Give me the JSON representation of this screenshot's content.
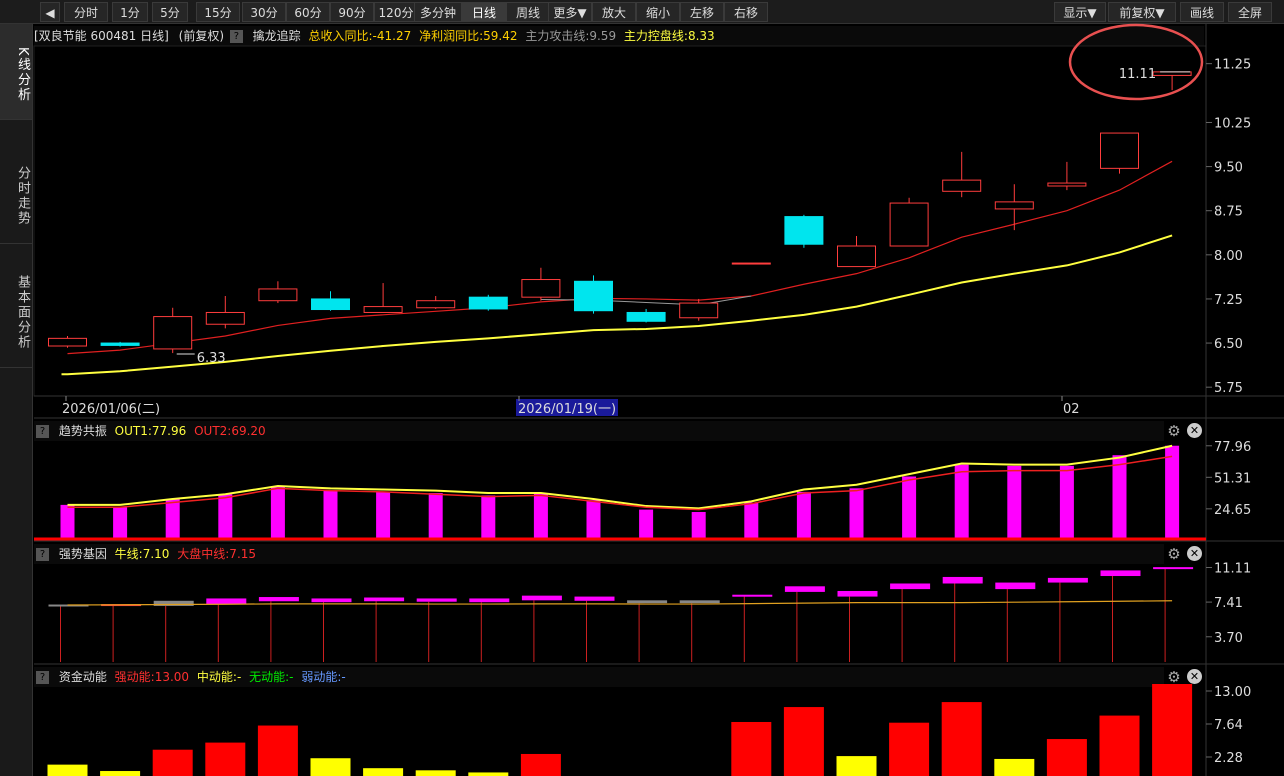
{
  "toolbar": {
    "buttons": [
      "分时",
      "1分",
      "5分",
      "15分",
      "30分",
      "60分",
      "90分",
      "120分",
      "多分钟",
      "日线",
      "周线",
      "更多▼",
      "放大",
      "缩小",
      "左移",
      "右移"
    ],
    "active": "日线",
    "right_buttons": [
      "显示▼",
      "前复权▼",
      "画线",
      "全屏"
    ]
  },
  "sidenav": {
    "items": [
      "K线分析",
      "分时走势",
      "基本面分析"
    ]
  },
  "main_panel": {
    "title": "[双良节能 600481 日线]",
    "adjust": "(前复权)",
    "indicator_name": "擒龙追踪",
    "revenue_label": "总收入同比:-41.27",
    "profit_label": "净利润同比:59.42",
    "attack_label": "主力攻击线:9.59",
    "control_label": "主力控盘线:8.33",
    "high_label": "11.11",
    "low_label": "6.33",
    "y_ticks": [
      "11.25",
      "10.25",
      "9.50",
      "8.75",
      "8.00",
      "7.25",
      "6.50",
      "5.75"
    ],
    "dates": [
      "2026/01/06(二)",
      "2026/01/19(一)",
      "02"
    ]
  },
  "colors": {
    "up": "#ff3d3d",
    "down": "#00e5ee",
    "ma_yellow": "#ffff40",
    "magenta": "#ff00ff"
  },
  "panel2": {
    "name": "趋势共振",
    "out1": "OUT1:77.96",
    "out2": "OUT2:69.20",
    "y_ticks": [
      "77.96",
      "51.31",
      "24.65"
    ]
  },
  "panel3": {
    "name": "强势基因",
    "bull": "牛线:7.10",
    "mid": "大盘中线:7.15",
    "y_ticks": [
      "11.11",
      "7.41",
      "3.70"
    ]
  },
  "panel4": {
    "name": "资金动能",
    "strong": "强动能:13.00",
    "medium": "中动能:-",
    "none": "无动能:-",
    "weak": "弱动能:-",
    "y_ticks": [
      "13.00",
      "7.64",
      "2.28"
    ]
  },
  "chart_data": {
    "type": "candlestick",
    "candles": [
      {
        "o": 6.45,
        "c": 6.58,
        "h": 6.62,
        "l": 6.42
      },
      {
        "o": 6.5,
        "c": 6.46,
        "h": 6.52,
        "l": 6.44
      },
      {
        "o": 6.4,
        "c": 6.95,
        "h": 7.1,
        "l": 6.33
      },
      {
        "o": 6.82,
        "c": 7.02,
        "h": 7.3,
        "l": 6.75
      },
      {
        "o": 7.22,
        "c": 7.42,
        "h": 7.55,
        "l": 7.18
      },
      {
        "o": 7.25,
        "c": 7.07,
        "h": 7.38,
        "l": 7.05
      },
      {
        "o": 7.02,
        "c": 7.12,
        "h": 7.52,
        "l": 7.02
      },
      {
        "o": 7.1,
        "c": 7.22,
        "h": 7.3,
        "l": 7.08
      },
      {
        "o": 7.28,
        "c": 7.08,
        "h": 7.32,
        "l": 7.05
      },
      {
        "o": 7.28,
        "c": 7.58,
        "h": 7.78,
        "l": 7.22
      },
      {
        "o": 7.55,
        "c": 7.05,
        "h": 7.65,
        "l": 7.0
      },
      {
        "o": 7.02,
        "c": 6.87,
        "h": 7.08,
        "l": 6.85
      },
      {
        "o": 6.93,
        "c": 7.18,
        "h": 7.25,
        "l": 6.88
      },
      {
        "o": 7.85,
        "c": 7.86,
        "h": 7.86,
        "l": 7.84
      },
      {
        "o": 8.65,
        "c": 8.18,
        "h": 8.68,
        "l": 8.12
      },
      {
        "o": 7.8,
        "c": 8.15,
        "h": 8.32,
        "l": 7.8
      },
      {
        "o": 8.15,
        "c": 8.88,
        "h": 8.97,
        "l": 8.15
      },
      {
        "o": 9.08,
        "c": 9.27,
        "h": 9.75,
        "l": 8.98
      },
      {
        "o": 8.78,
        "c": 8.9,
        "h": 9.2,
        "l": 8.42
      },
      {
        "o": 9.17,
        "c": 9.22,
        "h": 9.58,
        "l": 9.1
      },
      {
        "o": 9.47,
        "c": 10.07,
        "h": 10.07,
        "l": 9.38
      },
      {
        "o": 11.05,
        "c": 11.11,
        "h": 11.11,
        "l": 10.8
      }
    ],
    "ma_red": [
      6.32,
      6.38,
      6.5,
      6.62,
      6.8,
      6.92,
      6.98,
      7.04,
      7.1,
      7.2,
      7.26,
      7.25,
      7.23,
      7.3,
      7.5,
      7.68,
      7.95,
      8.3,
      8.52,
      8.75,
      9.1,
      9.59
    ],
    "ma_yellow": [
      5.97,
      6.02,
      6.1,
      6.18,
      6.28,
      6.37,
      6.45,
      6.52,
      6.58,
      6.65,
      6.72,
      6.74,
      6.79,
      6.88,
      6.98,
      7.12,
      7.32,
      7.53,
      7.68,
      7.82,
      8.04,
      8.33
    ],
    "y_range": [
      5.6,
      11.55
    ],
    "trend_bars": [
      28,
      26,
      33,
      37,
      43,
      40,
      39,
      38,
      36,
      38,
      32,
      24,
      22,
      30,
      39,
      42,
      52,
      62,
      61,
      61,
      70,
      78
    ],
    "trend_out1": [
      28,
      28,
      33,
      37,
      44,
      42,
      41,
      40,
      38,
      38,
      33,
      27,
      25,
      31,
      41,
      45,
      54,
      63,
      62,
      62,
      68,
      78
    ],
    "trend_out2": [
      26,
      26,
      30,
      34,
      42,
      40,
      39,
      37,
      35,
      36,
      31,
      26,
      24,
      29,
      38,
      40,
      49,
      56,
      57,
      57,
      62,
      69
    ],
    "gene_bars": [
      {
        "lo": 7.05,
        "hi": 7.15,
        "c": "#888"
      },
      {
        "lo": 7.15,
        "hi": 7.2,
        "c": "#ff3d3d"
      },
      {
        "lo": 7.0,
        "hi": 7.55,
        "c": "#888"
      },
      {
        "lo": 7.2,
        "hi": 7.8,
        "c": "#ff00ff"
      },
      {
        "lo": 7.5,
        "hi": 7.95,
        "c": "#ff00ff"
      },
      {
        "lo": 7.4,
        "hi": 7.8,
        "c": "#ff00ff"
      },
      {
        "lo": 7.5,
        "hi": 7.9,
        "c": "#ff00ff"
      },
      {
        "lo": 7.45,
        "hi": 7.8,
        "c": "#ff00ff"
      },
      {
        "lo": 7.4,
        "hi": 7.8,
        "c": "#ff00ff"
      },
      {
        "lo": 7.6,
        "hi": 8.1,
        "c": "#ff00ff"
      },
      {
        "lo": 7.55,
        "hi": 8.0,
        "c": "#ff00ff"
      },
      {
        "lo": 7.3,
        "hi": 7.6,
        "c": "#888"
      },
      {
        "lo": 7.3,
        "hi": 7.6,
        "c": "#888"
      },
      {
        "lo": 8.1,
        "hi": 8.2,
        "c": "#ff00ff"
      },
      {
        "lo": 8.5,
        "hi": 9.1,
        "c": "#ff00ff"
      },
      {
        "lo": 8.0,
        "hi": 8.6,
        "c": "#ff00ff"
      },
      {
        "lo": 8.8,
        "hi": 9.4,
        "c": "#ff00ff"
      },
      {
        "lo": 9.4,
        "hi": 10.1,
        "c": "#ff00ff"
      },
      {
        "lo": 8.8,
        "hi": 9.5,
        "c": "#ff00ff"
      },
      {
        "lo": 9.5,
        "hi": 10.0,
        "c": "#ff00ff"
      },
      {
        "lo": 10.2,
        "hi": 10.8,
        "c": "#ff00ff"
      },
      {
        "lo": 11.05,
        "hi": 11.15,
        "c": "#ff00ff"
      }
    ],
    "gene_line": [
      7.1,
      7.12,
      7.15,
      7.18,
      7.22,
      7.22,
      7.22,
      7.2,
      7.2,
      7.22,
      7.22,
      7.2,
      7.2,
      7.25,
      7.3,
      7.35,
      7.35,
      7.35,
      7.4,
      7.45,
      7.5,
      7.55
    ],
    "fund_bars": [
      {
        "v": 2.5,
        "c": "#ffff00"
      },
      {
        "v": 1.6,
        "c": "#ffff00"
      },
      {
        "v": 4.6,
        "c": "#ff0000"
      },
      {
        "v": 5.6,
        "c": "#ff0000"
      },
      {
        "v": 8.0,
        "c": "#ff0000"
      },
      {
        "v": 3.4,
        "c": "#ffff00"
      },
      {
        "v": 2.0,
        "c": "#ffff00"
      },
      {
        "v": 1.7,
        "c": "#ffff00"
      },
      {
        "v": 1.4,
        "c": "#ffff00"
      },
      {
        "v": 4.0,
        "c": "#ff0000"
      },
      {
        "v": 0.4,
        "c": "#ffff00"
      },
      {
        "v": 0.9,
        "c": "#00ff00"
      },
      {
        "v": 0.9,
        "c": "#6699ff"
      },
      {
        "v": 8.5,
        "c": "#ff0000"
      },
      {
        "v": 10.6,
        "c": "#ff0000"
      },
      {
        "v": 3.7,
        "c": "#ffff00"
      },
      {
        "v": 8.4,
        "c": "#ff0000"
      },
      {
        "v": 11.3,
        "c": "#ff0000"
      },
      {
        "v": 3.3,
        "c": "#ffff00"
      },
      {
        "v": 6.1,
        "c": "#ff0000"
      },
      {
        "v": 9.4,
        "c": "#ff0000"
      },
      {
        "v": 15.5,
        "c": "#ff0000"
      }
    ]
  }
}
